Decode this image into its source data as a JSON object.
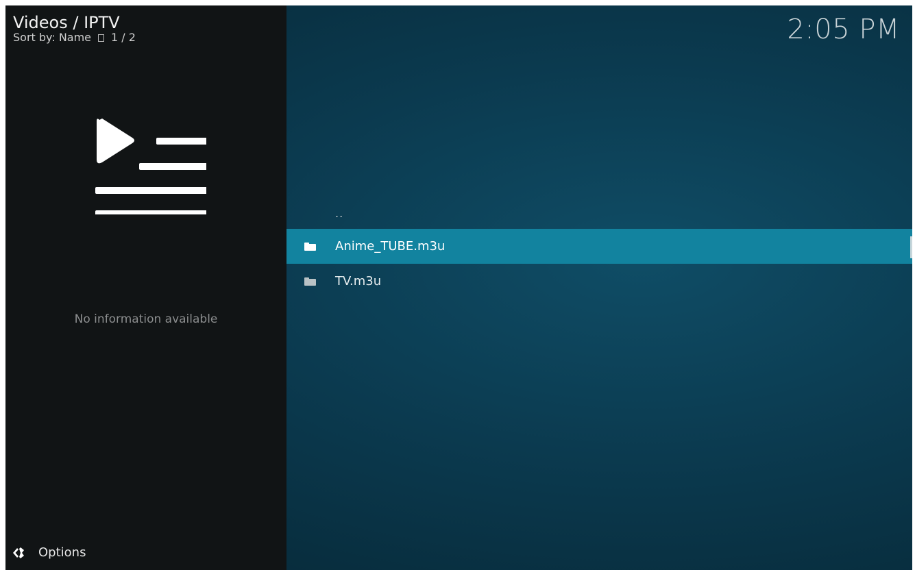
{
  "header": {
    "title": "Videos / IPTV",
    "sort_label": "Sort by: Name",
    "page_indicator": "1 / 2"
  },
  "clock": "2:05 PM",
  "info_panel": {
    "icon": "playlist-icon",
    "message": "No information available"
  },
  "footer": {
    "options_icon": "options-icon",
    "options_label": "Options"
  },
  "list": {
    "parent_label": "..",
    "items": [
      {
        "label": "Anime_TUBE.m3u",
        "icon": "folder-icon",
        "selected": true
      },
      {
        "label": "TV.m3u",
        "icon": "folder-icon",
        "selected": false
      }
    ]
  },
  "colors": {
    "selection": "#12839f",
    "sidebar_bg": "#111415",
    "main_bg": "#0b3d52"
  }
}
